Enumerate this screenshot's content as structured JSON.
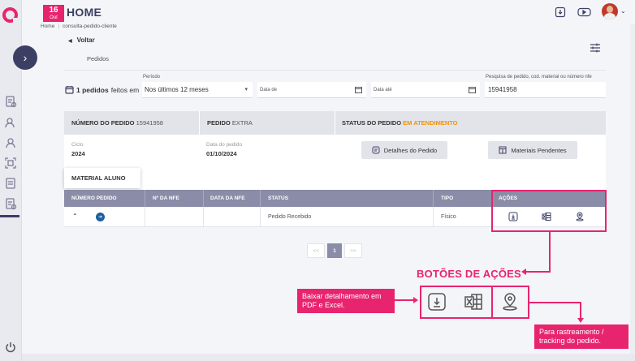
{
  "header": {
    "date_day": "16",
    "date_month": "Out",
    "title": "HOME",
    "breadcrumb": [
      "Home",
      "consulta-pedido-cliente"
    ]
  },
  "nav": {
    "back_label": "Voltar",
    "tab_label": "Pedidos"
  },
  "filters": {
    "count_bold": "1 pedidos",
    "count_rest": "feitos em",
    "period_label": "Período",
    "period_value": "Nos últimos 12 meses",
    "date_from_placeholder": "Data de",
    "date_to_placeholder": "Data até",
    "search_label": "Pesquisa de pedido, cod. material ou número nfe",
    "search_value": "15941958"
  },
  "order": {
    "number_label": "NÚMERO DO PEDIDO",
    "number_value": "15941958",
    "type_label": "PEDIDO",
    "type_value": "EXTRA",
    "status_label": "STATUS DO PEDIDO",
    "status_value": "EM ATENDIMENTO",
    "cycle_label": "Ciclo",
    "cycle_value": "2024",
    "date_label": "Data do pedido",
    "date_value": "01/10/2024",
    "details_button": "Detalhes do Pedido",
    "pending_button": "Materiais Pendentes",
    "material_tab": "MATERIAL ALUNO"
  },
  "table": {
    "columns": [
      "NÚMERO PEDIDO",
      "Nº DA NFE",
      "DATA DA NFE",
      "STATUS",
      "TIPO",
      "AÇÕES"
    ],
    "rows": [
      {
        "numero": "",
        "nfe": "",
        "data_nfe": "",
        "status": "Pedido Recebido",
        "tipo": "Físico"
      }
    ]
  },
  "pagination": {
    "prev": "<<",
    "current": "1",
    "next": ">>"
  },
  "annotations": {
    "title": "BOTÕES DE AÇÕES",
    "left_note": "Baixar detalhamento em PDF e Excel.",
    "right_note": "Para rastreamento / tracking do pedido."
  },
  "colors": {
    "accent": "#e8246f",
    "navy": "#3b3f63",
    "table_header": "#8b8ca7",
    "status_orange": "#f39200"
  }
}
